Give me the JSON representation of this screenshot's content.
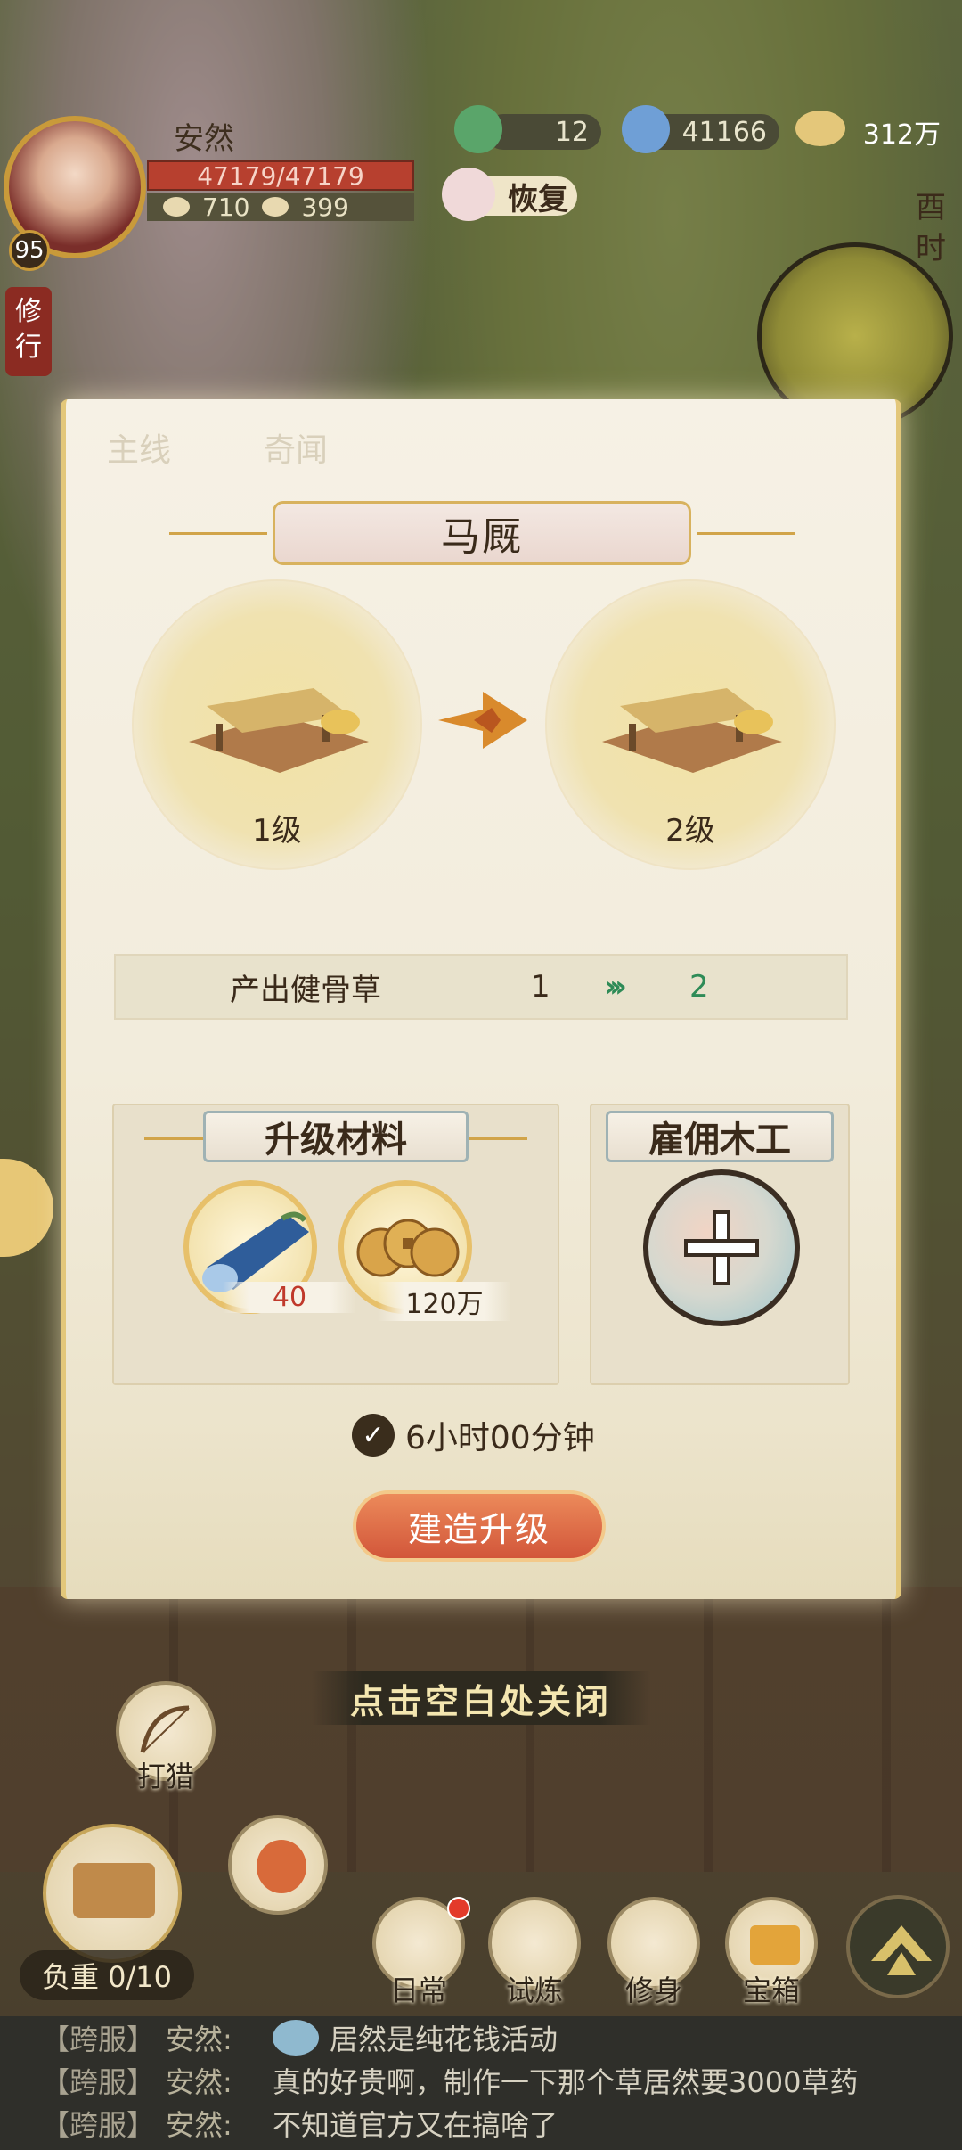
{
  "player": {
    "name": "安然",
    "level": "95",
    "hp": "47179/47179",
    "stat_a": "710",
    "stat_b": "399"
  },
  "resources": {
    "jade": "12",
    "scroll": "41166",
    "coins": "312万"
  },
  "restore_label": "恢复",
  "time_of_day": "酉时",
  "side_labels": {
    "xiuxing": "修行"
  },
  "modal": {
    "tabs": [
      "主线",
      "奇闻"
    ],
    "title": "马厩",
    "from_level": "1级",
    "to_level": "2级",
    "production": {
      "label": "产出健骨草",
      "from": "1",
      "to": "2"
    },
    "materials": {
      "title": "升级材料",
      "items": [
        {
          "icon": "blue-wood-log-icon",
          "count": "40",
          "count_color": "#c0392b"
        },
        {
          "icon": "copper-coins-icon",
          "count": "120万",
          "count_color": "#3a2a1a"
        }
      ]
    },
    "hire": {
      "title": "雇佣木工"
    },
    "duration": "6小时00分钟",
    "build_button": "建造升级"
  },
  "close_hint": "点击空白处关闭",
  "bottom": {
    "hunt": "打猎",
    "load": "负重 0/10",
    "nav": [
      "日常",
      "试炼",
      "修身",
      "宝箱"
    ]
  },
  "chat": [
    {
      "channel": "【跨服】",
      "speaker": "安然:",
      "emoji": "crying-face-icon",
      "text": "居然是纯花钱活动"
    },
    {
      "channel": "【跨服】",
      "speaker": "安然:",
      "text": "真的好贵啊，制作一下那个草居然要3000草药"
    },
    {
      "channel": "【跨服】",
      "speaker": "安然:",
      "text": "不知道官方又在搞啥了"
    }
  ],
  "colors": {
    "accent_gold": "#e3c77a",
    "button_red": "#d2563a",
    "production_arrow": "#2e8b57"
  }
}
